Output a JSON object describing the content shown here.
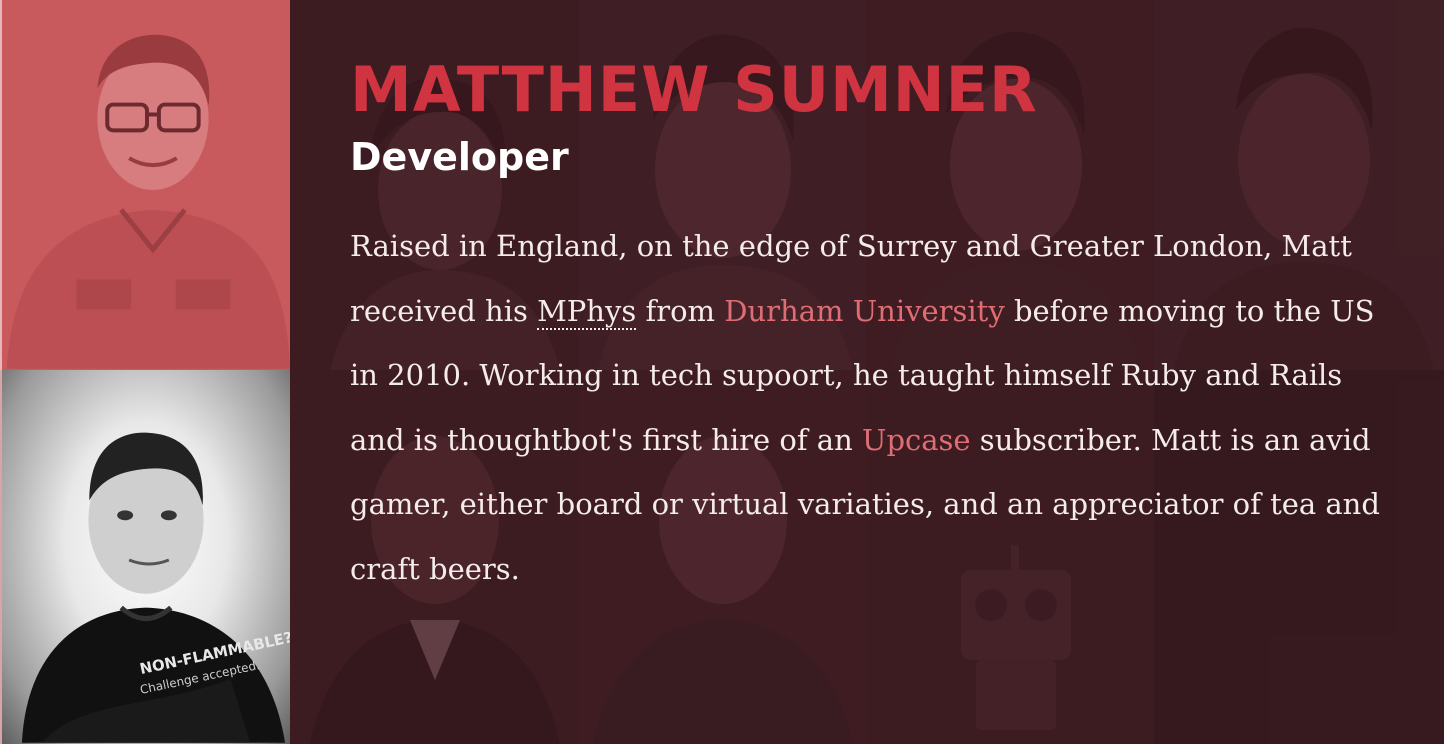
{
  "profile": {
    "name": "MATTHEW SUMNER",
    "role": "Developer",
    "bio": {
      "part1": "Raised in England, on the edge of Surrey and Greater London, Matt received his ",
      "abbr": "MPhys",
      "part2": " from ",
      "link1": "Durham University",
      "part3": " before moving to the US in 2010. Working in tech supoort, he taught himself Ruby and Rails and is thoughtbot's first hire of an ",
      "link2": "Upcase",
      "part4": " subscriber. Matt is an avid gamer, either board or virtual variaties, and an appreciator of tea and craft beers."
    }
  },
  "colors": {
    "accent": "#cf3440",
    "link": "#e06d74",
    "background": "#3d2125",
    "portrait_tint": "#c85a5d"
  }
}
